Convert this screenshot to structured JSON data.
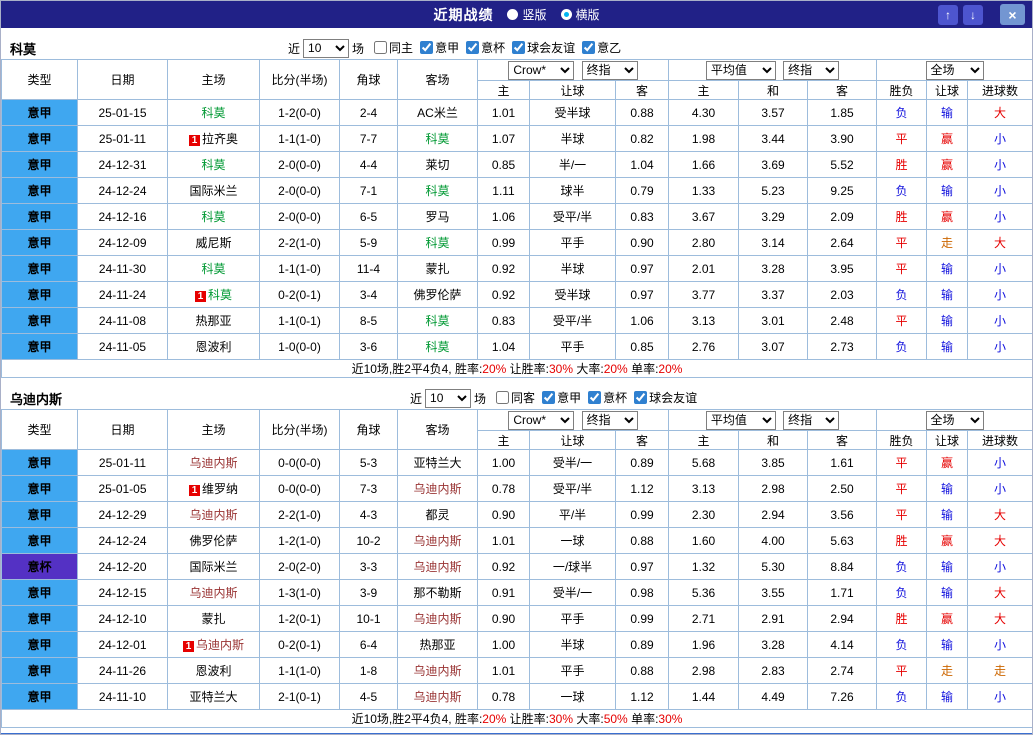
{
  "header": {
    "title": "近期战绩",
    "layout_options": [
      {
        "label": "竖版",
        "selected": false
      },
      {
        "label": "横版",
        "selected": true
      }
    ],
    "buttons": {
      "up": "↑",
      "down": "↓",
      "close": "×"
    }
  },
  "controls": {
    "near_label": "近",
    "count": "10",
    "matches_label": "场"
  },
  "table_header": {
    "col_type": "类型",
    "col_date": "日期",
    "col_home": "主场",
    "col_score": "比分(半场)",
    "col_corner": "角球",
    "col_away": "客场",
    "odds_group": {
      "select1": "Crow*",
      "select2": "终指",
      "cols": [
        "主",
        "让球",
        "客"
      ]
    },
    "avg_group": {
      "select1": "平均值",
      "select2": "终指",
      "cols": [
        "主",
        "和",
        "客"
      ]
    },
    "result_group": {
      "select1": "全场",
      "cols": [
        "胜负",
        "让球",
        "进球数"
      ]
    }
  },
  "badges": {
    "red_card": "1"
  },
  "colors": {
    "titlebar_bg": "#212187",
    "score_red": "#e60000",
    "summary_highlight": "#e60000"
  },
  "league_colors": {
    "意甲": "#3fa7f0",
    "意杯": "#5431c4"
  },
  "result_colors": {
    "胜": "#e60000",
    "平": "#e60000",
    "负": "#1111dd",
    "赢": "#e60000",
    "输": "#1111dd",
    "走": "#cc6600",
    "大": "#e60000",
    "小": "#1111dd"
  },
  "sections": [
    {
      "team": "科莫",
      "focus_color": "#009933",
      "filters": [
        {
          "label": "同主",
          "checked": false
        },
        {
          "label": "意甲",
          "checked": true
        },
        {
          "label": "意杯",
          "checked": true
        },
        {
          "label": "球会友谊",
          "checked": true
        },
        {
          "label": "意乙",
          "checked": true
        }
      ],
      "rows": [
        {
          "league": "意甲",
          "date": "25-01-15",
          "home": "科莫",
          "home_focus": true,
          "score": "1-2(0-0)",
          "corner": "2-4",
          "away": "AC米兰",
          "odds": [
            "1.01",
            "受半球",
            "0.88"
          ],
          "avg": [
            "4.30",
            "3.57",
            "1.85"
          ],
          "result": [
            "负",
            "输",
            "大"
          ]
        },
        {
          "league": "意甲",
          "date": "25-01-11",
          "home": "拉齐奥",
          "home_red": true,
          "score": "1-1(1-0)",
          "corner": "7-7",
          "away": "科莫",
          "away_focus": true,
          "odds": [
            "1.07",
            "半球",
            "0.82"
          ],
          "avg": [
            "1.98",
            "3.44",
            "3.90"
          ],
          "result": [
            "平",
            "赢",
            "小"
          ]
        },
        {
          "league": "意甲",
          "date": "24-12-31",
          "home": "科莫",
          "home_focus": true,
          "score": "2-0(0-0)",
          "corner": "4-4",
          "away": "莱切",
          "odds": [
            "0.85",
            "半/一",
            "1.04"
          ],
          "avg": [
            "1.66",
            "3.69",
            "5.52"
          ],
          "result": [
            "胜",
            "赢",
            "小"
          ]
        },
        {
          "league": "意甲",
          "date": "24-12-24",
          "home": "国际米兰",
          "score": "2-0(0-0)",
          "corner": "7-1",
          "away": "科莫",
          "away_focus": true,
          "odds": [
            "1.11",
            "球半",
            "0.79"
          ],
          "avg": [
            "1.33",
            "5.23",
            "9.25"
          ],
          "result": [
            "负",
            "输",
            "小"
          ]
        },
        {
          "league": "意甲",
          "date": "24-12-16",
          "home": "科莫",
          "home_focus": true,
          "score": "2-0(0-0)",
          "corner": "6-5",
          "away": "罗马",
          "odds": [
            "1.06",
            "受平/半",
            "0.83"
          ],
          "avg": [
            "3.67",
            "3.29",
            "2.09"
          ],
          "result": [
            "胜",
            "赢",
            "小"
          ]
        },
        {
          "league": "意甲",
          "date": "24-12-09",
          "home": "威尼斯",
          "score": "2-2(1-0)",
          "corner": "5-9",
          "away": "科莫",
          "away_focus": true,
          "odds": [
            "0.99",
            "平手",
            "0.90"
          ],
          "avg": [
            "2.80",
            "3.14",
            "2.64"
          ],
          "result": [
            "平",
            "走",
            "大"
          ]
        },
        {
          "league": "意甲",
          "date": "24-11-30",
          "home": "科莫",
          "home_focus": true,
          "score": "1-1(1-0)",
          "corner": "11-4",
          "away": "蒙扎",
          "odds": [
            "0.92",
            "半球",
            "0.97"
          ],
          "avg": [
            "2.01",
            "3.28",
            "3.95"
          ],
          "result": [
            "平",
            "输",
            "小"
          ]
        },
        {
          "league": "意甲",
          "date": "24-11-24",
          "home": "科莫",
          "home_focus": true,
          "home_red": true,
          "score": "0-2(0-1)",
          "corner": "3-4",
          "away": "佛罗伦萨",
          "odds": [
            "0.92",
            "受半球",
            "0.97"
          ],
          "avg": [
            "3.77",
            "3.37",
            "2.03"
          ],
          "result": [
            "负",
            "输",
            "小"
          ]
        },
        {
          "league": "意甲",
          "date": "24-11-08",
          "home": "热那亚",
          "score": "1-1(0-1)",
          "corner": "8-5",
          "away": "科莫",
          "away_focus": true,
          "odds": [
            "0.83",
            "受平/半",
            "1.06"
          ],
          "avg": [
            "3.13",
            "3.01",
            "2.48"
          ],
          "result": [
            "平",
            "输",
            "小"
          ]
        },
        {
          "league": "意甲",
          "date": "24-11-05",
          "home": "恩波利",
          "score": "1-0(0-0)",
          "corner": "3-6",
          "away": "科莫",
          "away_focus": true,
          "odds": [
            "1.04",
            "平手",
            "0.85"
          ],
          "avg": [
            "2.76",
            "3.07",
            "2.73"
          ],
          "result": [
            "负",
            "输",
            "小"
          ]
        }
      ],
      "summary": [
        {
          "text": "近10场,胜2平4负4, 胜率:",
          "red": false
        },
        {
          "text": "20%",
          "red": true
        },
        {
          "text": " 让胜率:",
          "red": false
        },
        {
          "text": "30%",
          "red": true
        },
        {
          "text": " 大率:",
          "red": false
        },
        {
          "text": "20%",
          "red": true
        },
        {
          "text": " 单率:",
          "red": false
        },
        {
          "text": "20%",
          "red": true
        }
      ]
    },
    {
      "team": "乌迪内斯",
      "focus_color": "#993333",
      "filters": [
        {
          "label": "同客",
          "checked": false
        },
        {
          "label": "意甲",
          "checked": true
        },
        {
          "label": "意杯",
          "checked": true
        },
        {
          "label": "球会友谊",
          "checked": true
        }
      ],
      "rows": [
        {
          "league": "意甲",
          "date": "25-01-11",
          "home": "乌迪内斯",
          "home_focus": true,
          "score": "0-0(0-0)",
          "corner": "5-3",
          "away": "亚特兰大",
          "odds": [
            "1.00",
            "受半/一",
            "0.89"
          ],
          "avg": [
            "5.68",
            "3.85",
            "1.61"
          ],
          "result": [
            "平",
            "赢",
            "小"
          ]
        },
        {
          "league": "意甲",
          "date": "25-01-05",
          "home": "维罗纳",
          "home_red": true,
          "score": "0-0(0-0)",
          "corner": "7-3",
          "away": "乌迪内斯",
          "away_focus": true,
          "odds": [
            "0.78",
            "受平/半",
            "1.12"
          ],
          "avg": [
            "3.13",
            "2.98",
            "2.50"
          ],
          "result": [
            "平",
            "输",
            "小"
          ]
        },
        {
          "league": "意甲",
          "date": "24-12-29",
          "home": "乌迪内斯",
          "home_focus": true,
          "score": "2-2(1-0)",
          "corner": "4-3",
          "away": "都灵",
          "odds": [
            "0.90",
            "平/半",
            "0.99"
          ],
          "avg": [
            "2.30",
            "2.94",
            "3.56"
          ],
          "result": [
            "平",
            "输",
            "大"
          ]
        },
        {
          "league": "意甲",
          "date": "24-12-24",
          "home": "佛罗伦萨",
          "score": "1-2(1-0)",
          "corner": "10-2",
          "away": "乌迪内斯",
          "away_focus": true,
          "odds": [
            "1.01",
            "一球",
            "0.88"
          ],
          "avg": [
            "1.60",
            "4.00",
            "5.63"
          ],
          "result": [
            "胜",
            "赢",
            "大"
          ]
        },
        {
          "league": "意杯",
          "date": "24-12-20",
          "home": "国际米兰",
          "score": "2-0(2-0)",
          "corner": "3-3",
          "away": "乌迪内斯",
          "away_focus": true,
          "odds": [
            "0.92",
            "一/球半",
            "0.97"
          ],
          "avg": [
            "1.32",
            "5.30",
            "8.84"
          ],
          "result": [
            "负",
            "输",
            "小"
          ]
        },
        {
          "league": "意甲",
          "date": "24-12-15",
          "home": "乌迪内斯",
          "home_focus": true,
          "score": "1-3(1-0)",
          "corner": "3-9",
          "away": "那不勒斯",
          "odds": [
            "0.91",
            "受半/一",
            "0.98"
          ],
          "avg": [
            "5.36",
            "3.55",
            "1.71"
          ],
          "result": [
            "负",
            "输",
            "大"
          ]
        },
        {
          "league": "意甲",
          "date": "24-12-10",
          "home": "蒙扎",
          "score": "1-2(0-1)",
          "corner": "10-1",
          "away": "乌迪内斯",
          "away_focus": true,
          "odds": [
            "0.90",
            "平手",
            "0.99"
          ],
          "avg": [
            "2.71",
            "2.91",
            "2.94"
          ],
          "result": [
            "胜",
            "赢",
            "大"
          ]
        },
        {
          "league": "意甲",
          "date": "24-12-01",
          "home": "乌迪内斯",
          "home_focus": true,
          "home_red": true,
          "score": "0-2(0-1)",
          "corner": "6-4",
          "away": "热那亚",
          "odds": [
            "1.00",
            "半球",
            "0.89"
          ],
          "avg": [
            "1.96",
            "3.28",
            "4.14"
          ],
          "result": [
            "负",
            "输",
            "小"
          ]
        },
        {
          "league": "意甲",
          "date": "24-11-26",
          "home": "恩波利",
          "score": "1-1(1-0)",
          "corner": "1-8",
          "away": "乌迪内斯",
          "away_focus": true,
          "odds": [
            "1.01",
            "平手",
            "0.88"
          ],
          "avg": [
            "2.98",
            "2.83",
            "2.74"
          ],
          "result": [
            "平",
            "走",
            "走"
          ]
        },
        {
          "league": "意甲",
          "date": "24-11-10",
          "home": "亚特兰大",
          "score": "2-1(0-1)",
          "corner": "4-5",
          "away": "乌迪内斯",
          "away_focus": true,
          "odds": [
            "0.78",
            "一球",
            "1.12"
          ],
          "avg": [
            "1.44",
            "4.49",
            "7.26"
          ],
          "result": [
            "负",
            "输",
            "小"
          ]
        }
      ],
      "summary": [
        {
          "text": "近10场,胜2平4负4, 胜率:",
          "red": false
        },
        {
          "text": "20%",
          "red": true
        },
        {
          "text": " 让胜率:",
          "red": false
        },
        {
          "text": "30%",
          "red": true
        },
        {
          "text": " 大率:",
          "red": false
        },
        {
          "text": "50%",
          "red": true
        },
        {
          "text": " 单率:",
          "red": false
        },
        {
          "text": "30%",
          "red": true
        }
      ]
    }
  ]
}
